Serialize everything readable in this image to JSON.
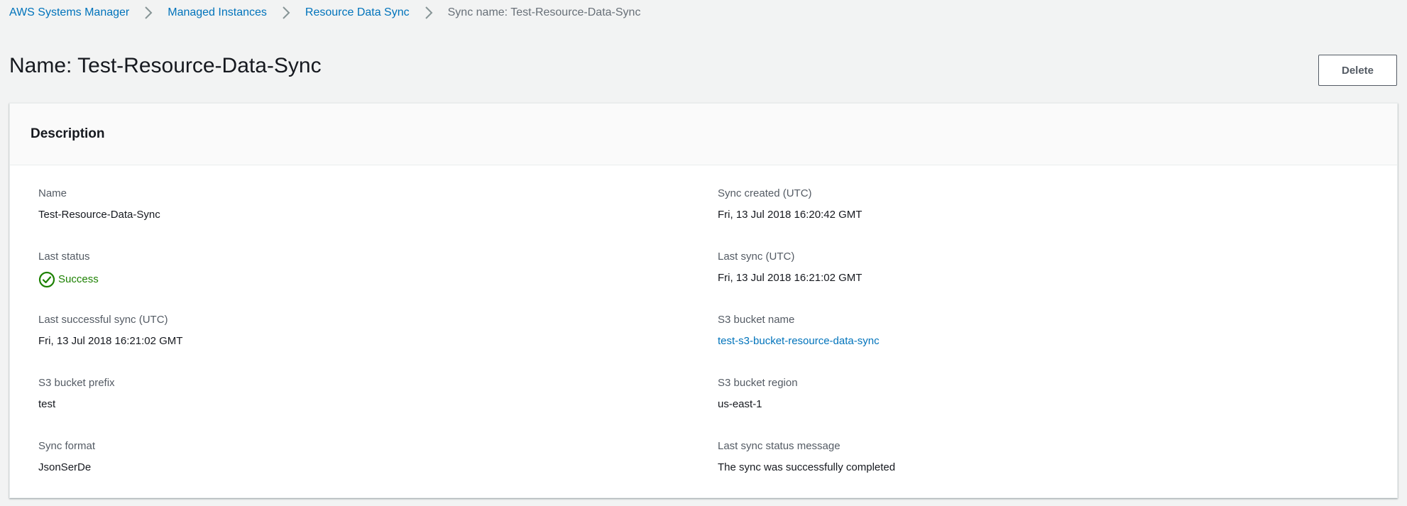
{
  "breadcrumb": {
    "items": [
      {
        "label": "AWS Systems Manager"
      },
      {
        "label": "Managed Instances"
      },
      {
        "label": "Resource Data Sync"
      }
    ],
    "current": "Sync name: Test-Resource-Data-Sync"
  },
  "header": {
    "title": "Name: Test-Resource-Data-Sync",
    "delete_label": "Delete"
  },
  "panel": {
    "title": "Description",
    "left": [
      {
        "label": "Name",
        "value": "Test-Resource-Data-Sync"
      },
      {
        "label": "Last status",
        "value": "Success"
      },
      {
        "label": "Last successful sync (UTC)",
        "value": "Fri, 13 Jul 2018 16:21:02 GMT"
      },
      {
        "label": "S3 bucket prefix",
        "value": "test"
      },
      {
        "label": "Sync format",
        "value": "JsonSerDe"
      }
    ],
    "right": [
      {
        "label": "Sync created (UTC)",
        "value": "Fri, 13 Jul 2018 16:20:42 GMT"
      },
      {
        "label": "Last sync (UTC)",
        "value": "Fri, 13 Jul 2018 16:21:02 GMT"
      },
      {
        "label": "S3 bucket name",
        "value": "test-s3-bucket-resource-data-sync"
      },
      {
        "label": "S3 bucket region",
        "value": "us-east-1"
      },
      {
        "label": "Last sync status message",
        "value": "The sync was successfully completed"
      }
    ]
  },
  "icons": {
    "breadcrumb_separator": "chevron-right-icon",
    "status": "check-circle-icon"
  },
  "colors": {
    "link": "#0073bb",
    "success": "#1d8102",
    "background": "#f2f3f3",
    "label": "#545b64"
  }
}
